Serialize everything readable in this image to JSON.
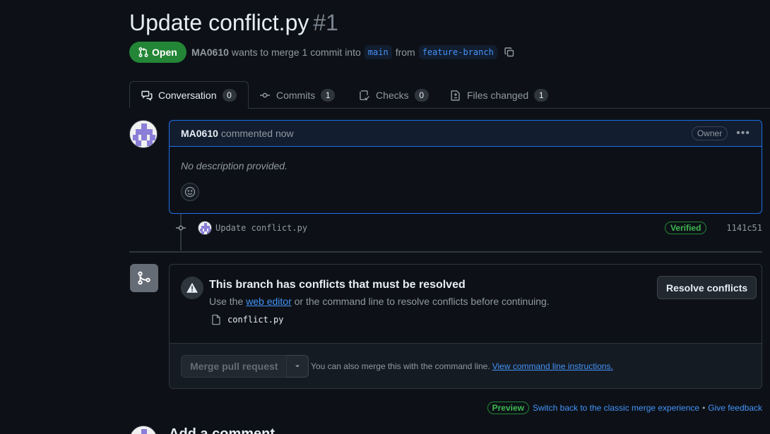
{
  "pr": {
    "title": "Update conflict.py",
    "number": "#1",
    "state": "Open",
    "author": "MA0610",
    "merge_text_1": "wants to merge 1 commit into",
    "base_branch": "main",
    "merge_text_2": "from",
    "head_branch": "feature-branch"
  },
  "tabs": [
    {
      "label": "Conversation",
      "count": "0"
    },
    {
      "label": "Commits",
      "count": "1"
    },
    {
      "label": "Checks",
      "count": "0"
    },
    {
      "label": "Files changed",
      "count": "1"
    }
  ],
  "comment": {
    "author": "MA0610",
    "time": "commented now",
    "role": "Owner",
    "body": "No description provided."
  },
  "commit": {
    "message": "Update conflict.py",
    "status": "Verified",
    "sha": "1141c51"
  },
  "merge_box": {
    "title": "This branch has conflicts that must be resolved",
    "desc_prefix": "Use the",
    "desc_link": "web editor",
    "desc_suffix": "or the command line to resolve conflicts before continuing.",
    "file": "conflict.py",
    "resolve_label": "Resolve conflicts",
    "merge_label": "Merge pull request",
    "hint_text": "You can also merge this with the command line.",
    "hint_link": "View command line instructions."
  },
  "feedback": {
    "badge": "Preview",
    "switch_link": "Switch back to the classic merge experience",
    "separator": "•",
    "feedback_link": "Give feedback"
  },
  "add_comment": {
    "title": "Add a comment"
  },
  "colors": {
    "background": "#0d1117",
    "open_green": "#238636",
    "link_blue": "#4493f8",
    "highlight_border": "#1f6feb"
  }
}
